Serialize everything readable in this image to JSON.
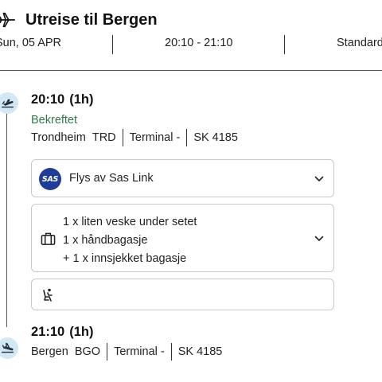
{
  "header": {
    "title": "Utreise til Bergen",
    "icon": "airplane-icon"
  },
  "meta": {
    "date": "Sun, 05 APR",
    "time_range": "20:10 - 21:10",
    "fare_class": "Standard"
  },
  "departure": {
    "time": "20:10",
    "duration": "(1h)",
    "status": "Bekreftet",
    "city": "Trondheim",
    "code": "TRD",
    "terminal": "Terminal -",
    "flight": "SK 4185",
    "icon": "takeoff-icon"
  },
  "airline_card": {
    "logo_text": "SAS",
    "label": "Flys av Sas Link"
  },
  "baggage_card": {
    "lines": [
      "1 x liten veske under setet",
      "1 x håndbagasje",
      "+ 1 x innsjekket bagasje"
    ]
  },
  "arrival": {
    "time": "21:10",
    "duration": "(1h)",
    "city": "Bergen",
    "code": "BGO",
    "terminal": "Terminal -",
    "flight": "SK 4185",
    "icon": "landing-icon"
  },
  "colors": {
    "status_green": "#2f7a4a",
    "node_bg": "#d2e8f4",
    "sas_blue": "#1f3d96",
    "card_border": "#c9c9c9"
  }
}
